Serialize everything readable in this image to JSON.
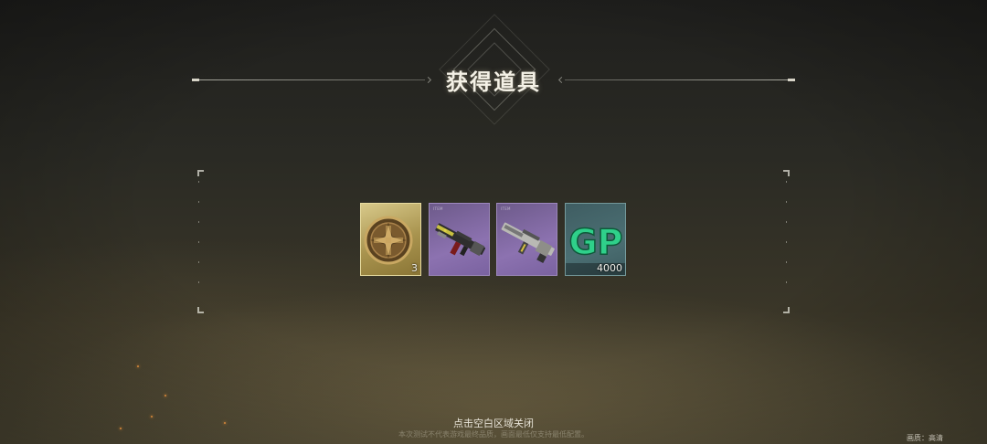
{
  "screen": {
    "title": "获得道具",
    "close_hint": "点击空白区域关闭",
    "disclaimer": "本次测试不代表游戏最终品质，画面最低仅支持最低配置。",
    "quality_label": "画质：高清"
  },
  "items": [
    {
      "name": "token-medal",
      "rarity": "gold",
      "tag": "ITEM",
      "count": "3"
    },
    {
      "name": "rifle-skin-1",
      "rarity": "purple",
      "tag": "ITEM",
      "count": ""
    },
    {
      "name": "rifle-skin-2",
      "rarity": "purple",
      "tag": "ITEM",
      "count": ""
    },
    {
      "name": "gp-currency",
      "rarity": "teal",
      "tag": "GP",
      "count": "4000"
    }
  ],
  "colors": {
    "gold": "#c8b56e",
    "purple": "#8c72b0",
    "teal": "#4b6f73",
    "gp_green": "#2fd08a"
  },
  "icons": [
    "medal-icon",
    "rifle-icon",
    "rifle-icon",
    "gp-icon"
  ]
}
